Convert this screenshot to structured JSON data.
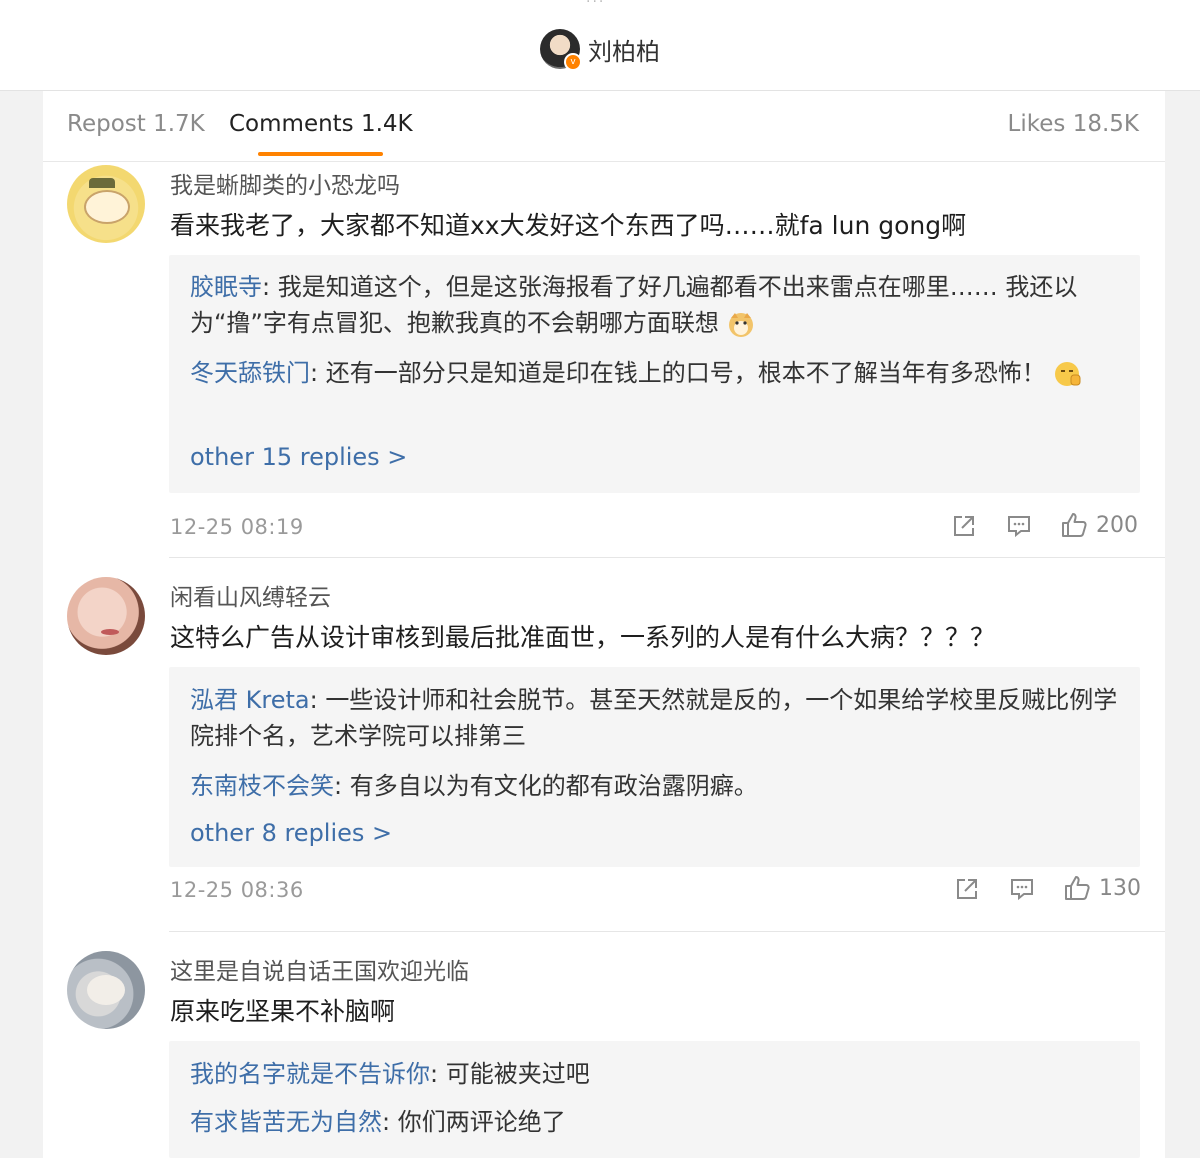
{
  "header": {
    "username": "刘柏柏",
    "dots": "···"
  },
  "tabs": {
    "repost": "Repost 1.7K",
    "comments": "Comments 1.4K",
    "likes": "Likes 18.5K"
  },
  "colors": {
    "accent": "#ff8200",
    "link": "#3e6ea8"
  },
  "comments": [
    {
      "name": "我是蜥脚类的小恐龙吗",
      "text": "看来我老了，大家都不知道xx大发好这个东西了吗……就fa lun gong啊",
      "replies": [
        {
          "name": "胶眠寺",
          "sep": ": ",
          "text": "我是知道这个，但是这张海报看了好几遍都看不出来雷点在哪里…… 我还以为“撸”字有点冒犯、抱歉我真的不会朝哪方面联想"
        },
        {
          "name": "冬天舔铁门",
          "sep": ": ",
          "text": "还有一部分只是知道是印在钱上的口号，根本不了解当年有多恐怖！"
        }
      ],
      "more": "other 15 replies >",
      "time": "12-25 08:19",
      "likes": "200"
    },
    {
      "name": "闲看山风缚轻云",
      "text": "这特么广告从设计审核到最后批准面世，一系列的人是有什么大病？？？？",
      "replies": [
        {
          "name": "泓君 Kreta",
          "sep": ": ",
          "text": "一些设计师和社会脱节。甚至天然就是反的，一个如果给学校里反贼比例学院排个名，艺术学院可以排第三"
        },
        {
          "name": "东南枝不会笑",
          "sep": ": ",
          "text": "有多自以为有文化的都有政治露阴癖。"
        }
      ],
      "more": "other 8 replies >",
      "time": "12-25 08:36",
      "likes": "130"
    },
    {
      "name": "这里是自说自话王国欢迎光临",
      "text": "原来吃坚果不补脑啊",
      "replies": [
        {
          "name": "我的名字就是不告诉你",
          "sep": ": ",
          "text": "可能被夹过吧"
        },
        {
          "name": "有求皆苦无为自然",
          "sep": ": ",
          "text": "你们两评论绝了"
        }
      ]
    }
  ]
}
